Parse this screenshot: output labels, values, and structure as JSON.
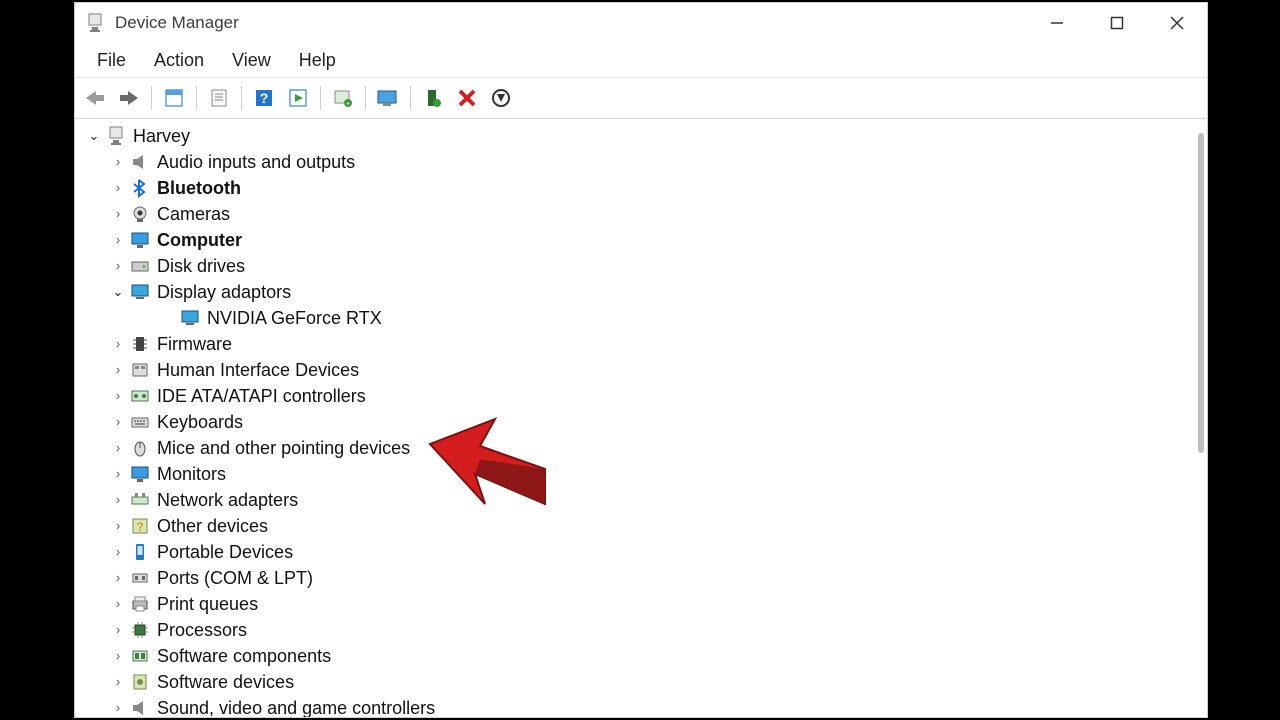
{
  "window": {
    "title": "Device Manager"
  },
  "menu": {
    "file": "File",
    "action": "Action",
    "view": "View",
    "help": "Help"
  },
  "tree": {
    "root": "Harvey",
    "nodes": [
      {
        "label": "Audio inputs and outputs",
        "icon": "speaker",
        "expanded": false
      },
      {
        "label": "Bluetooth",
        "icon": "bluetooth",
        "expanded": false,
        "bold": true
      },
      {
        "label": "Cameras",
        "icon": "camera",
        "expanded": false
      },
      {
        "label": "Computer",
        "icon": "monitor",
        "expanded": false,
        "bold": true
      },
      {
        "label": "Disk drives",
        "icon": "disk",
        "expanded": false
      },
      {
        "label": "Display adaptors",
        "icon": "display",
        "expanded": true,
        "children": [
          {
            "label": "NVIDIA GeForce RTX",
            "icon": "display",
            "annotated": true
          }
        ]
      },
      {
        "label": "Firmware",
        "icon": "chip-vert",
        "expanded": false
      },
      {
        "label": "Human Interface Devices",
        "icon": "hid",
        "expanded": false
      },
      {
        "label": "IDE ATA/ATAPI controllers",
        "icon": "ide",
        "expanded": false
      },
      {
        "label": "Keyboards",
        "icon": "keyboard",
        "expanded": false
      },
      {
        "label": "Mice and other pointing devices",
        "icon": "mouse",
        "expanded": false
      },
      {
        "label": "Monitors",
        "icon": "monitor",
        "expanded": false
      },
      {
        "label": "Network adapters",
        "icon": "network",
        "expanded": false
      },
      {
        "label": "Other devices",
        "icon": "unknown",
        "expanded": false
      },
      {
        "label": "Portable Devices",
        "icon": "portable",
        "expanded": false
      },
      {
        "label": "Ports (COM & LPT)",
        "icon": "port",
        "expanded": false
      },
      {
        "label": "Print queues",
        "icon": "printer",
        "expanded": false
      },
      {
        "label": "Processors",
        "icon": "cpu",
        "expanded": false
      },
      {
        "label": "Software components",
        "icon": "component",
        "expanded": false
      },
      {
        "label": "Software devices",
        "icon": "softdev",
        "expanded": false
      },
      {
        "label": "Sound, video and game controllers",
        "icon": "speaker",
        "expanded": false
      }
    ]
  },
  "annotation": {
    "arrow_color_dark": "#8e1717",
    "arrow_color_light": "#d41e1e"
  }
}
